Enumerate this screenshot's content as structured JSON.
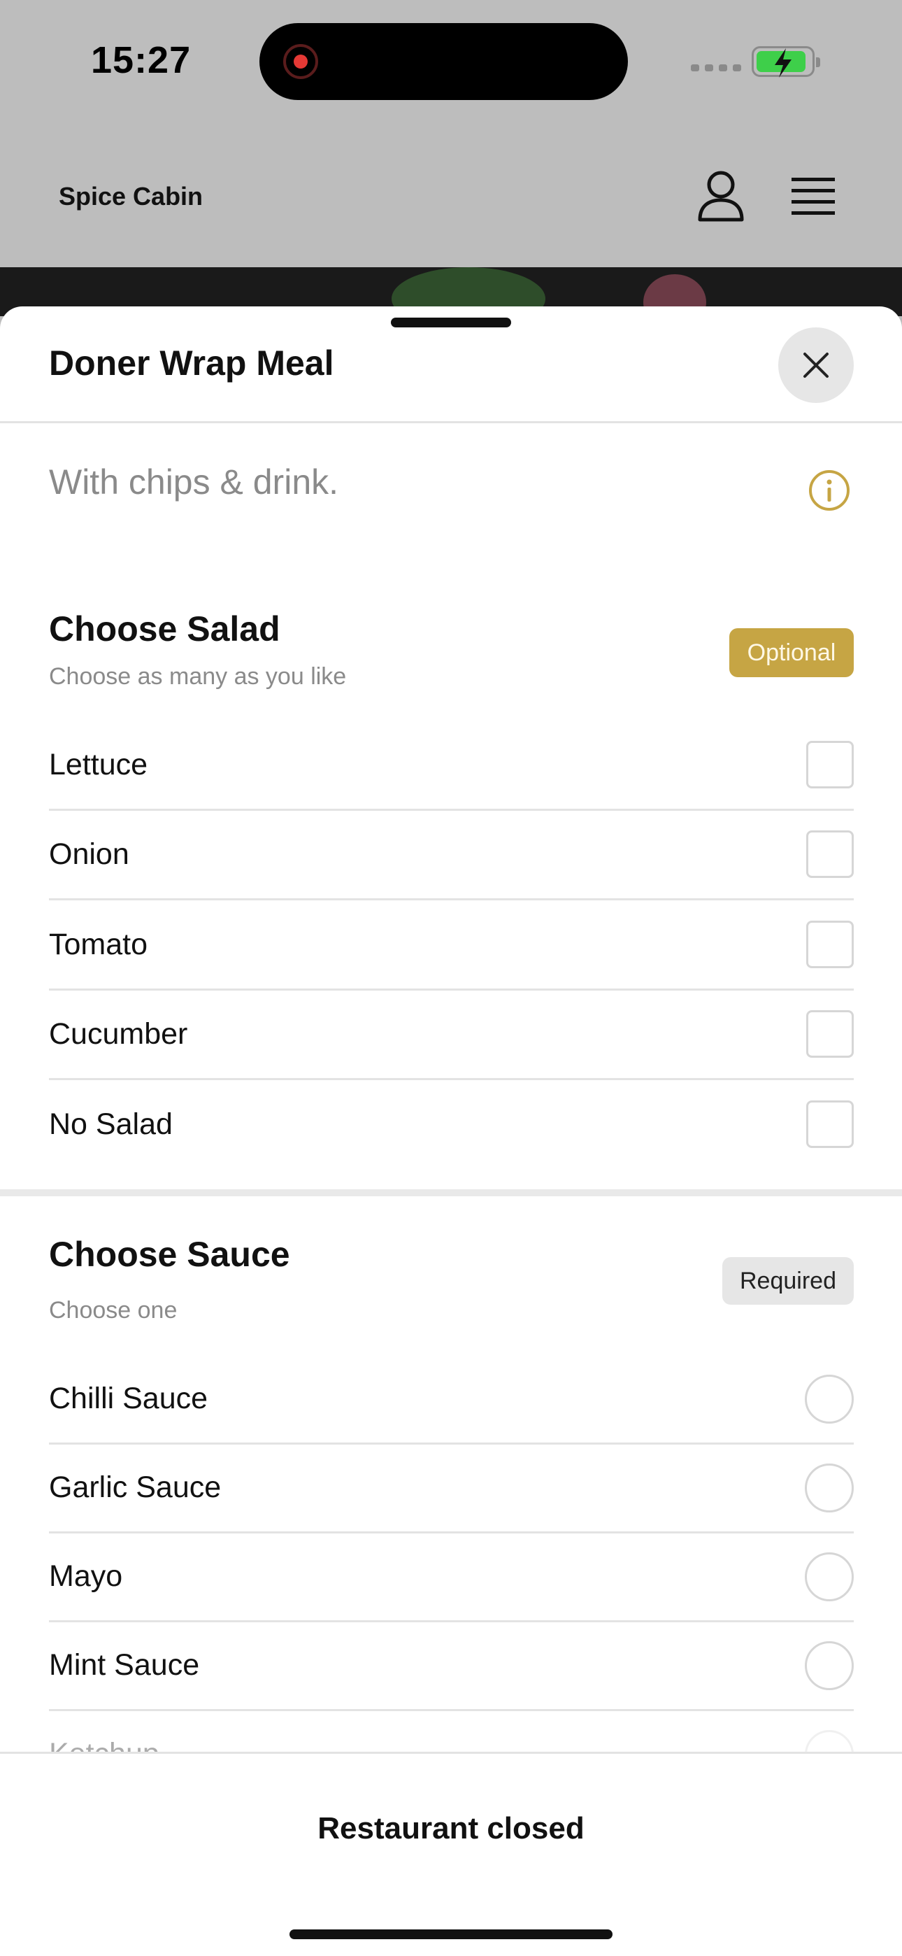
{
  "status_bar": {
    "time": "15:27"
  },
  "header": {
    "brand": "Spice Cabin"
  },
  "sheet": {
    "title": "Doner Wrap Meal",
    "description": "With chips & drink."
  },
  "sections": [
    {
      "title": "Choose Salad",
      "subtitle": "Choose as many as you like",
      "badge": "Optional",
      "control": "checkbox",
      "options": [
        "Lettuce",
        "Onion",
        "Tomato",
        "Cucumber",
        "No Salad"
      ]
    },
    {
      "title": "Choose Sauce",
      "subtitle": "Choose one",
      "badge": "Required",
      "control": "radio",
      "options": [
        "Chilli Sauce",
        "Garlic Sauce",
        "Mayo",
        "Mint Sauce",
        "Ketchup"
      ]
    }
  ],
  "footer": {
    "status": "Restaurant closed"
  },
  "colors": {
    "accent": "#c6a544",
    "battery": "#3ecf4a",
    "record": "#e53935"
  },
  "icons": [
    "record-icon",
    "battery-icon",
    "user-icon",
    "menu-icon",
    "close-icon",
    "info-icon"
  ]
}
